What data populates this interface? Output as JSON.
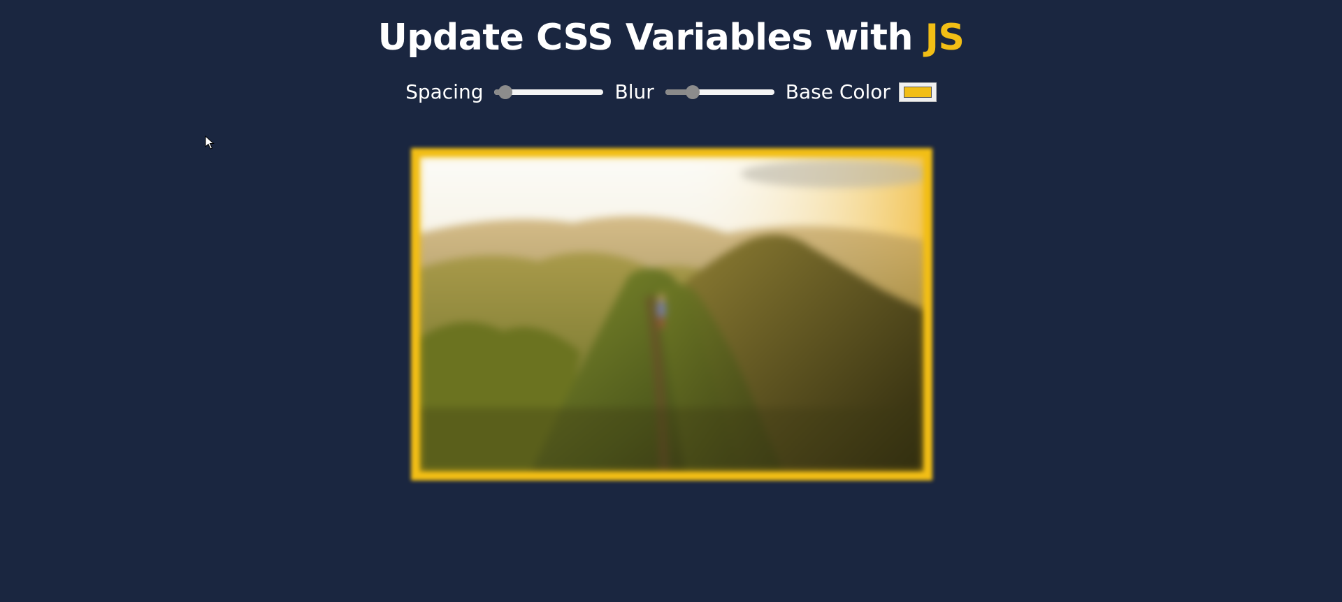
{
  "header": {
    "title_main": "Update CSS Variables with",
    "title_highlight": "JS"
  },
  "controls": {
    "spacing": {
      "label": "Spacing",
      "value_fraction": 0.1
    },
    "blur": {
      "label": "Blur",
      "value_fraction": 0.25
    },
    "base_color": {
      "label": "Base Color",
      "value": "#f2be15"
    }
  },
  "colors": {
    "background": "#1a2640",
    "accent": "#f2be15"
  },
  "image": {
    "subject": "hiker on green mountain ridge at sunrise"
  },
  "icons": {
    "cursor": "mouse-pointer-icon"
  }
}
